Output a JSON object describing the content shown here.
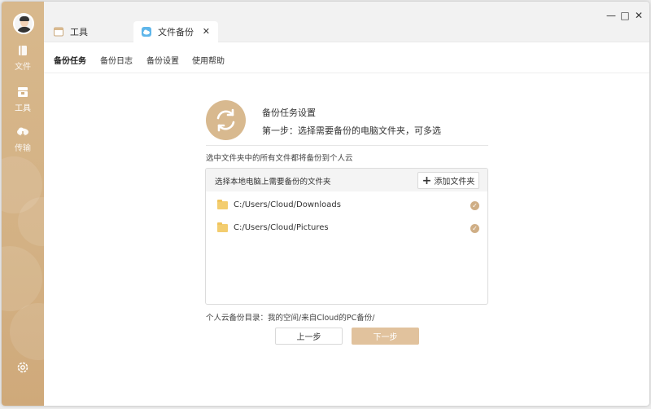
{
  "sidebar": {
    "items": [
      {
        "label": "文件",
        "icon": "file-icon"
      },
      {
        "label": "工具",
        "icon": "toolbox-icon"
      },
      {
        "label": "传输",
        "icon": "cloud-transfer-icon"
      }
    ],
    "settings_icon": "gear-icon"
  },
  "tabs": [
    {
      "label": "工具",
      "icon": "toolbox-icon"
    },
    {
      "label": "文件备份",
      "icon": "cloud-backup-icon",
      "close": "✕"
    }
  ],
  "window_controls": {
    "minimize": "—",
    "maximize": "□",
    "close": "✕"
  },
  "subnav": [
    "备份任务",
    "备份日志",
    "备份设置",
    "使用帮助"
  ],
  "main": {
    "title": "备份任务设置",
    "step": "第一步：选择需要备份的电脑文件夹，可多选",
    "description": "选中文件夹中的所有文件都将备份到个人云",
    "panel_header": "选择本地电脑上需要备份的文件夹",
    "add_button": "添加文件夹",
    "folders": [
      {
        "path": "C:/Users/Cloud/Downloads",
        "checked": true
      },
      {
        "path": "C:/Users/Cloud/Pictures",
        "checked": true
      }
    ],
    "destination": "个人云备份目录：我的空间/来自Cloud的PC备份/",
    "prev_button": "上一步",
    "next_button": "下一步"
  },
  "colors": {
    "accent": "#d8b98f",
    "sidebar": "#d3b184",
    "next_button": "#e1c29d"
  }
}
